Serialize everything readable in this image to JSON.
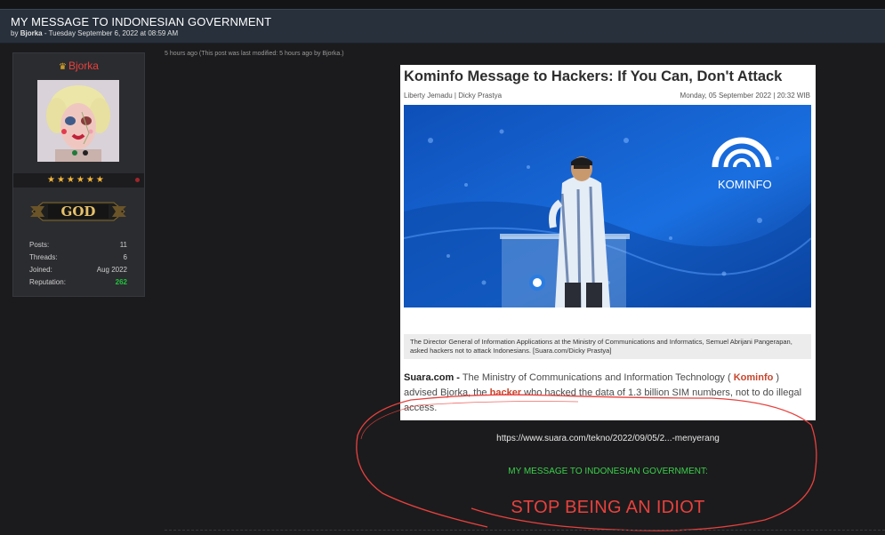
{
  "thread": {
    "title": "MY MESSAGE TO INDONESIAN GOVERNMENT",
    "by_label": "by",
    "author": "Bjorka",
    "date": "- Tuesday September 6, 2022 at 08:59 AM"
  },
  "user": {
    "name": "Bjorka",
    "stars": "★★★★★★",
    "rank": "GOD",
    "stats": [
      {
        "label": "Posts:",
        "value": "11"
      },
      {
        "label": "Threads:",
        "value": "6"
      },
      {
        "label": "Joined:",
        "value": "Aug 2022"
      },
      {
        "label": "Reputation:",
        "value": "262"
      }
    ]
  },
  "post": {
    "meta": "5 hours ago   (This post was last modified: 5 hours ago by Bjorka.)",
    "link": "https://www.suara.com/tekno/2022/09/05/2...-menyerang",
    "message": "MY MESSAGE TO INDONESIAN GOVERNMENT:",
    "shout": "STOP BEING AN IDIOT"
  },
  "article": {
    "title": "Kominfo Message to Hackers: If You Can, Don't Attack",
    "authors": "Liberty Jemadu | Dicky Prastya",
    "date": "Monday, 05 September 2022 | 20:32 WIB",
    "logo_text": "KOMINFO",
    "caption": "The Director General of Information Applications at the Ministry of Communications and Informatics, Semuel Abrijani Pangerapan, asked hackers not to attack Indonesians. [Suara.com/Dicky Prastya]",
    "body": {
      "source": "Suara.com -",
      "p1": " The Ministry of Communications and Information Technology ( ",
      "kominfo": "Kominfo",
      "p2": " ) advised Bjorka, the ",
      "hacker": "hacker",
      "p3": " who hacked the data of 1.3 billion SIM numbers, not to do illegal access."
    }
  },
  "colors": {
    "header_bg": "#27303b",
    "username": "#e8413d",
    "reputation": "#21c33c",
    "message_green": "#3ad04a",
    "shout_red": "#e8413d",
    "article_link_red": "#c8452c"
  }
}
